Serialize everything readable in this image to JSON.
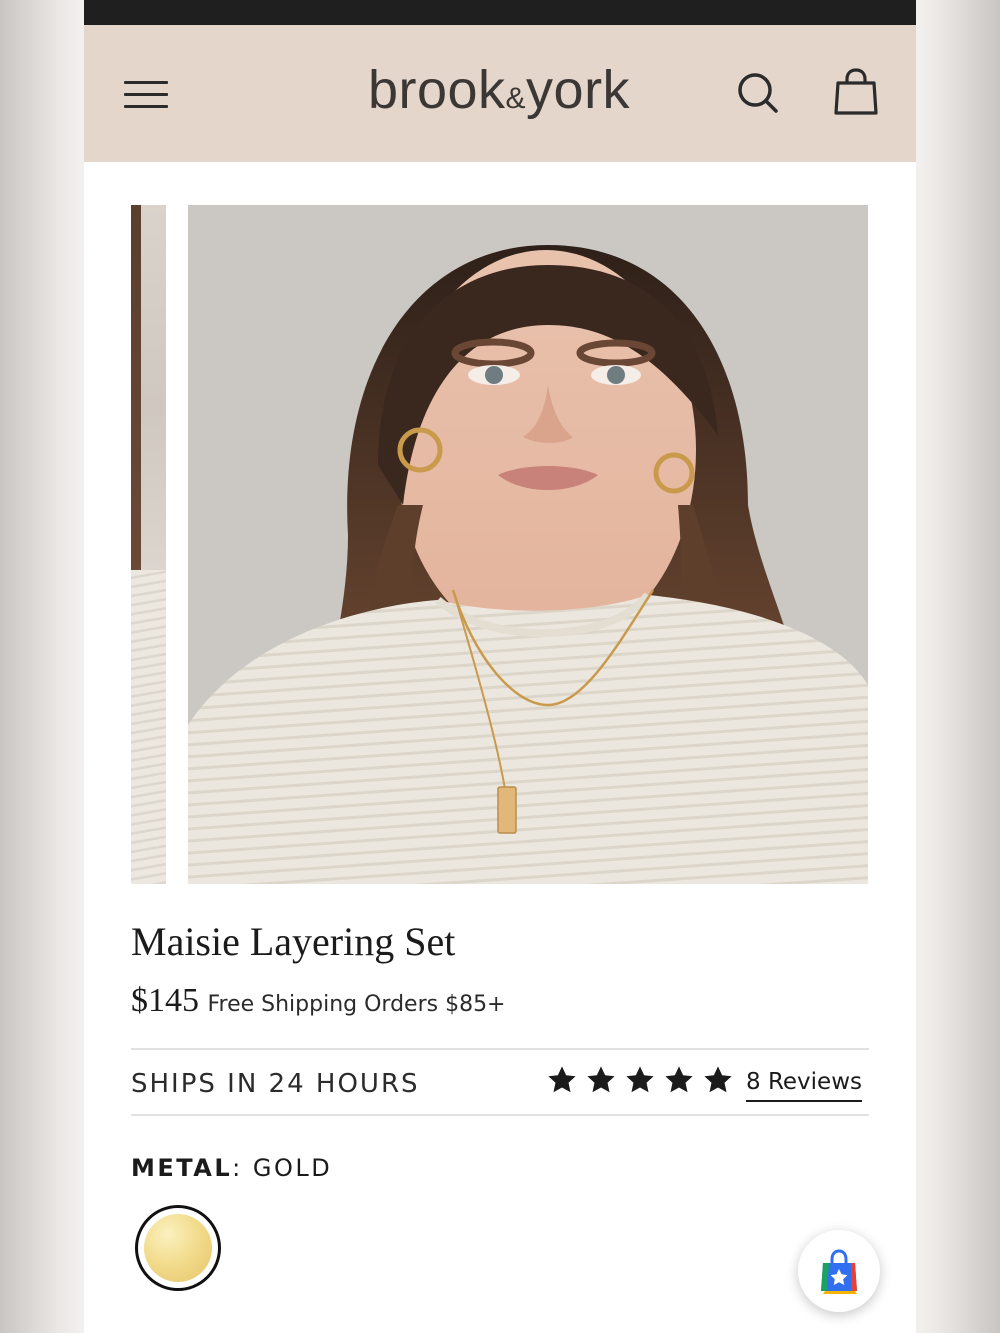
{
  "header": {
    "brand": "brook",
    "brand_amp": "&",
    "brand_end": "york"
  },
  "product": {
    "title": "Maisie Layering Set",
    "price": "$145",
    "shipping_note": "Free Shipping Orders $85+",
    "ships_note": "SHIPS IN 24 HOURS",
    "rating_stars": 5,
    "reviews_label": "8 Reviews",
    "metal_label": "METAL",
    "metal_separator": ":",
    "metal_value": "GOLD"
  },
  "colors": {
    "header_bg": "#e5d6cc",
    "text": "#1b1b1b",
    "gold_swatch": "#f2dc8e"
  },
  "icons": {
    "menu": "hamburger-icon",
    "search": "search-icon",
    "cart": "shopping-bag-icon",
    "star": "star-icon",
    "floating": "shop-app-icon"
  }
}
